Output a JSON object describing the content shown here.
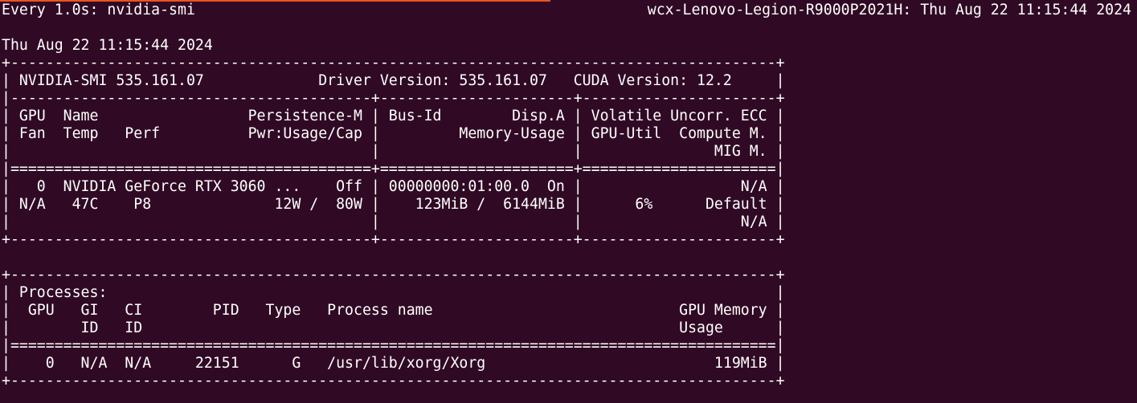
{
  "header": {
    "watch_command": "Every 1.0s: nvidia-smi",
    "host_and_time": "wcx-Lenovo-Legion-R9000P2021H: Thu Aug 22 11:15:44 2024"
  },
  "terminal_lines": [
    "Thu Aug 22 11:15:44 2024",
    "+---------------------------------------------------------------------------------------+",
    "| NVIDIA-SMI 535.161.07             Driver Version: 535.161.07   CUDA Version: 12.2     |",
    "|-----------------------------------------+----------------------+----------------------+",
    "| GPU  Name                 Persistence-M | Bus-Id        Disp.A | Volatile Uncorr. ECC |",
    "| Fan  Temp   Perf          Pwr:Usage/Cap |         Memory-Usage | GPU-Util  Compute M. |",
    "|                                         |                      |               MIG M. |",
    "|=========================================+======================+======================|",
    "|   0  NVIDIA GeForce RTX 3060 ...    Off | 00000000:01:00.0  On |                  N/A |",
    "| N/A   47C    P8              12W /  80W |    123MiB /  6144MiB |      6%      Default |",
    "|                                         |                      |                  N/A |",
    "+-----------------------------------------+----------------------+----------------------+",
    "",
    "+---------------------------------------------------------------------------------------+",
    "| Processes:                                                                            |",
    "|  GPU   GI   CI        PID   Type   Process name                            GPU Memory |",
    "|        ID   ID                                                             Usage      |",
    "|=======================================================================================|",
    "|    0   N/A  N/A     22151      G   /usr/lib/xorg/Xorg                          119MiB |",
    "+---------------------------------------------------------------------------------------+"
  ]
}
